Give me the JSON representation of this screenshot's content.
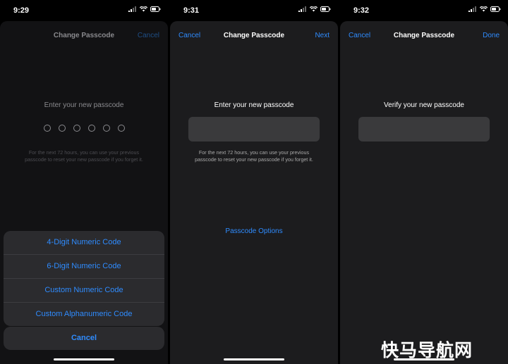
{
  "screens": [
    {
      "time": "9:29",
      "nav": {
        "title": "Change Passcode",
        "right": "Cancel"
      },
      "prompt": "Enter your new passcode",
      "hint": "For the next 72 hours, you can use your previous passcode to reset your new passcode if you forget it.",
      "action_sheet": {
        "items": [
          "4-Digit Numeric Code",
          "6-Digit Numeric Code",
          "Custom Numeric Code",
          "Custom Alphanumeric Code"
        ],
        "cancel": "Cancel"
      }
    },
    {
      "time": "9:31",
      "nav": {
        "left": "Cancel",
        "title": "Change Passcode",
        "right": "Next"
      },
      "prompt": "Enter your new passcode",
      "hint": "For the next 72 hours, you can use your previous passcode to reset your new passcode if you forget it.",
      "options_link": "Passcode Options"
    },
    {
      "time": "9:32",
      "nav": {
        "left": "Cancel",
        "title": "Change Passcode",
        "right": "Done"
      },
      "prompt": "Verify your new passcode"
    }
  ],
  "watermark": "快马导航网",
  "colors": {
    "accent": "#2f8cff",
    "sheet": "#1c1c1e",
    "field": "#3a3a3c"
  }
}
